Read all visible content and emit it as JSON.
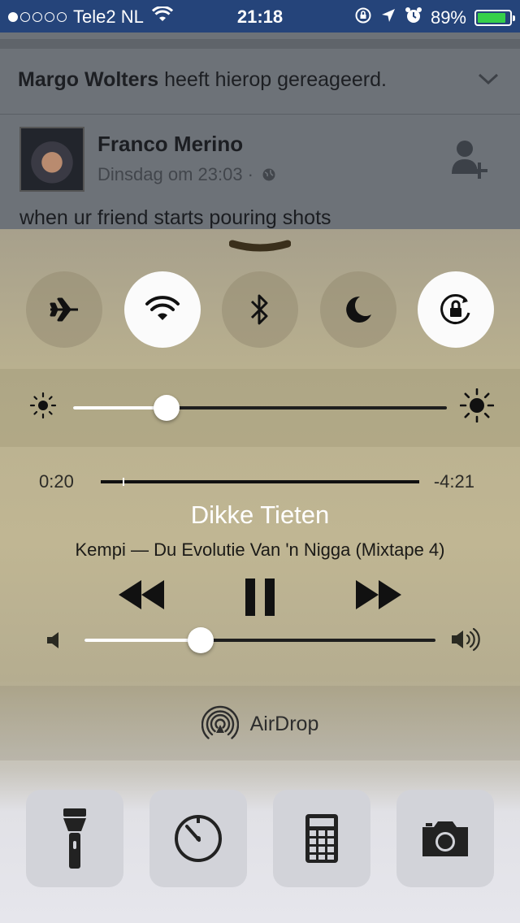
{
  "status_bar": {
    "carrier": "Tele2 NL",
    "time": "21:18",
    "battery": "89%",
    "battery_level": 0.89,
    "signal_strength": 1
  },
  "feed": {
    "notification": {
      "name": "Margo Wolters",
      "text": "heeft hierop gereageerd."
    },
    "post": {
      "author": "Franco Merino",
      "time": "Dinsdag om 23:03 ·",
      "text": "when ur friend starts pouring shots"
    }
  },
  "control_center": {
    "toggles": [
      {
        "name": "airplane-mode",
        "on": false
      },
      {
        "name": "wifi",
        "on": true
      },
      {
        "name": "bluetooth",
        "on": false
      },
      {
        "name": "do-not-disturb",
        "on": false
      },
      {
        "name": "rotation-lock",
        "on": true
      }
    ],
    "brightness": 0.25,
    "now_playing": {
      "elapsed": "0:20",
      "remaining": "-4:21",
      "progress": 0.07,
      "title": "Dikke Tieten",
      "artist_album": "Kempi — Du Evolutie Van 'n Nigga (Mixtape 4)"
    },
    "volume": 0.33,
    "airdrop_label": "AirDrop",
    "shortcuts": [
      "flashlight-icon",
      "timer-icon",
      "calculator-icon",
      "camera-icon"
    ],
    "accent_colors": {
      "status_bar": "#25447a",
      "battery": "#35d04a"
    }
  }
}
